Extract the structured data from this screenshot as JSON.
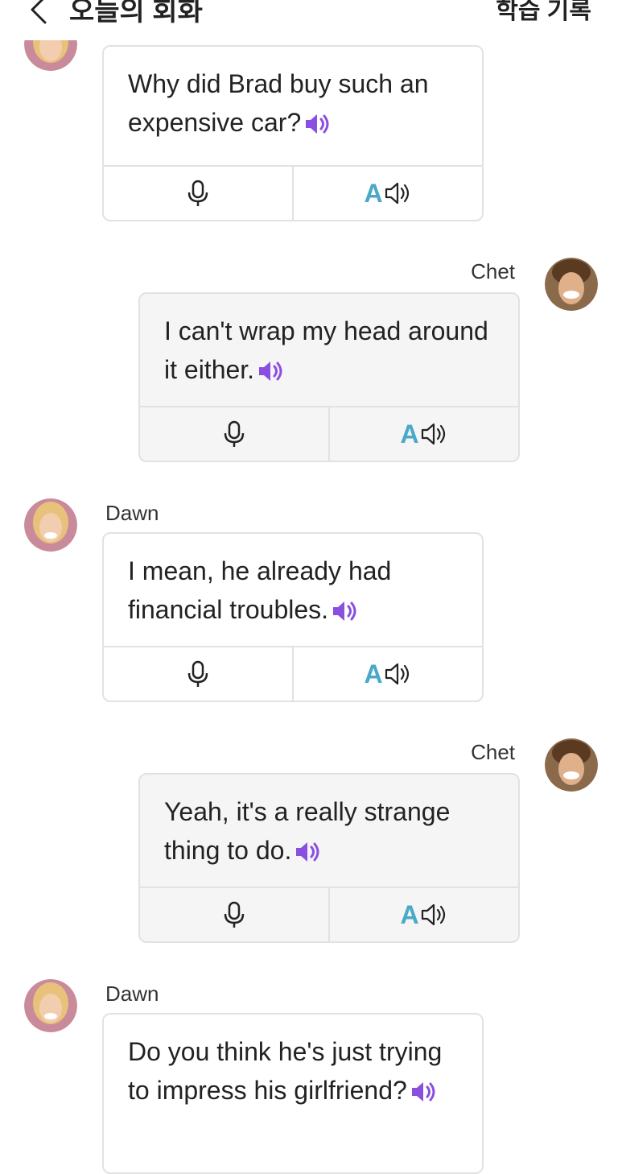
{
  "header": {
    "title": "오늘의 회화",
    "action_label": "학습 기록"
  },
  "colors": {
    "accent_purple": "#8a4fe0",
    "tts_blue": "#4aa9c6",
    "divider": "#e2e2e2"
  },
  "messages": [
    {
      "speaker": "",
      "side": "left",
      "text": "Why did Brad buy such an expensive car?"
    },
    {
      "speaker": "Chet",
      "side": "right",
      "text": "I can't wrap my head around it either."
    },
    {
      "speaker": "Dawn",
      "side": "left",
      "text": "I mean, he already had financial troubles."
    },
    {
      "speaker": "Chet",
      "side": "right",
      "text": "Yeah, it's a really strange thing to do."
    },
    {
      "speaker": "Dawn",
      "side": "left",
      "text": "Do you think he's just trying to impress his girlfriend?"
    }
  ],
  "actions": {
    "record_icon": "microphone-icon",
    "tts_letter": "A",
    "tts_icon": "speaker-outline-icon",
    "play_icon": "speaker-filled-icon"
  }
}
